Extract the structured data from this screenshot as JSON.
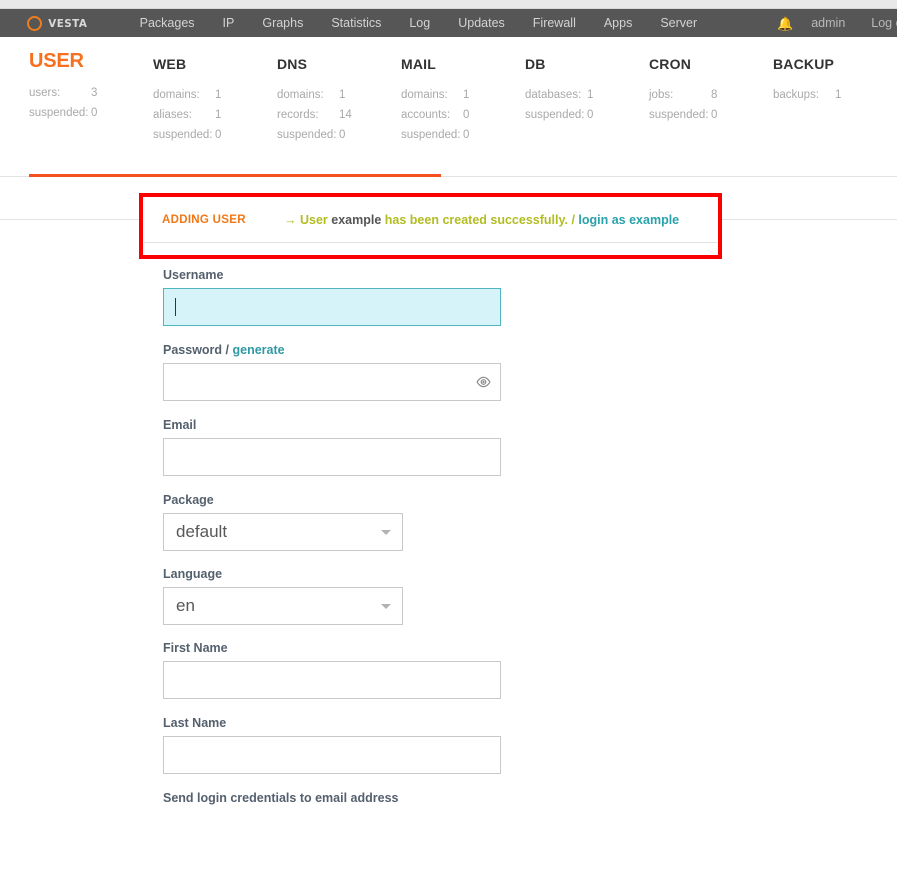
{
  "navbar": {
    "brand": {
      "word": "VESTA",
      "icon": "vesta-ring-icon"
    },
    "links": [
      {
        "label": "Packages"
      },
      {
        "label": "IP"
      },
      {
        "label": "Graphs"
      },
      {
        "label": "Statistics"
      },
      {
        "label": "Log"
      },
      {
        "label": "Updates"
      },
      {
        "label": "Firewall"
      },
      {
        "label": "Apps"
      },
      {
        "label": "Server"
      }
    ],
    "bell_icon": "bell-icon",
    "user": "admin",
    "logout": "Log out",
    "bell_color": "#b2bd22",
    "bg_color": "#565656"
  },
  "stats": [
    {
      "title": "USER",
      "active": true,
      "rows": [
        {
          "key": "users:",
          "value": "3"
        },
        {
          "key": "suspended:",
          "value": "0"
        }
      ]
    },
    {
      "title": "WEB",
      "active": false,
      "rows": [
        {
          "key": "domains:",
          "value": "1"
        },
        {
          "key": "aliases:",
          "value": "1"
        },
        {
          "key": "suspended:",
          "value": "0"
        }
      ]
    },
    {
      "title": "DNS",
      "active": false,
      "rows": [
        {
          "key": "domains:",
          "value": "1"
        },
        {
          "key": "records:",
          "value": "14"
        },
        {
          "key": "suspended:",
          "value": "0"
        }
      ]
    },
    {
      "title": "MAIL",
      "active": false,
      "rows": [
        {
          "key": "domains:",
          "value": "1"
        },
        {
          "key": "accounts:",
          "value": "0"
        },
        {
          "key": "suspended:",
          "value": "0"
        }
      ]
    },
    {
      "title": "DB",
      "active": false,
      "rows": [
        {
          "key": "databases:",
          "value": "1"
        },
        {
          "key": "suspended:",
          "value": "0"
        }
      ]
    },
    {
      "title": "CRON",
      "active": false,
      "rows": [
        {
          "key": "jobs:",
          "value": "8"
        },
        {
          "key": "suspended:",
          "value": "0"
        }
      ]
    },
    {
      "title": "BACKUP",
      "active": false,
      "rows": [
        {
          "key": "backups:",
          "value": "1"
        }
      ]
    }
  ],
  "banner": {
    "tag": "ADDING USER",
    "arrow": "→ User",
    "username": "example",
    "success_text": "has been created successfully. /",
    "login_link": "login as example",
    "border_color": "#fc0000",
    "green_color": "#b2bd22",
    "teal_color": "#29a2ab",
    "tag_color": "#f07818"
  },
  "form": {
    "username": {
      "label": "Username",
      "value": "",
      "placeholder": "",
      "focused": true
    },
    "password": {
      "label_main": "Password /",
      "label_link": "generate",
      "value": "",
      "placeholder": "",
      "eye_icon": "eye-icon"
    },
    "email": {
      "label": "Email",
      "value": "",
      "placeholder": ""
    },
    "package": {
      "label": "Package",
      "value": "default",
      "options": [
        "default"
      ]
    },
    "language": {
      "label": "Language",
      "value": "en",
      "options": [
        "en"
      ]
    },
    "first_name": {
      "label": "First Name",
      "value": "",
      "placeholder": ""
    },
    "last_name": {
      "label": "Last Name",
      "value": "",
      "placeholder": ""
    },
    "send_credentials": {
      "label": "Send login credentials to email address"
    }
  },
  "theme": {
    "accent_orange": "#f86f1e",
    "tab_bar_orange": "#f4511e",
    "focus_teal": "#4fb6c0",
    "focus_bg": "#d6f3f9"
  }
}
